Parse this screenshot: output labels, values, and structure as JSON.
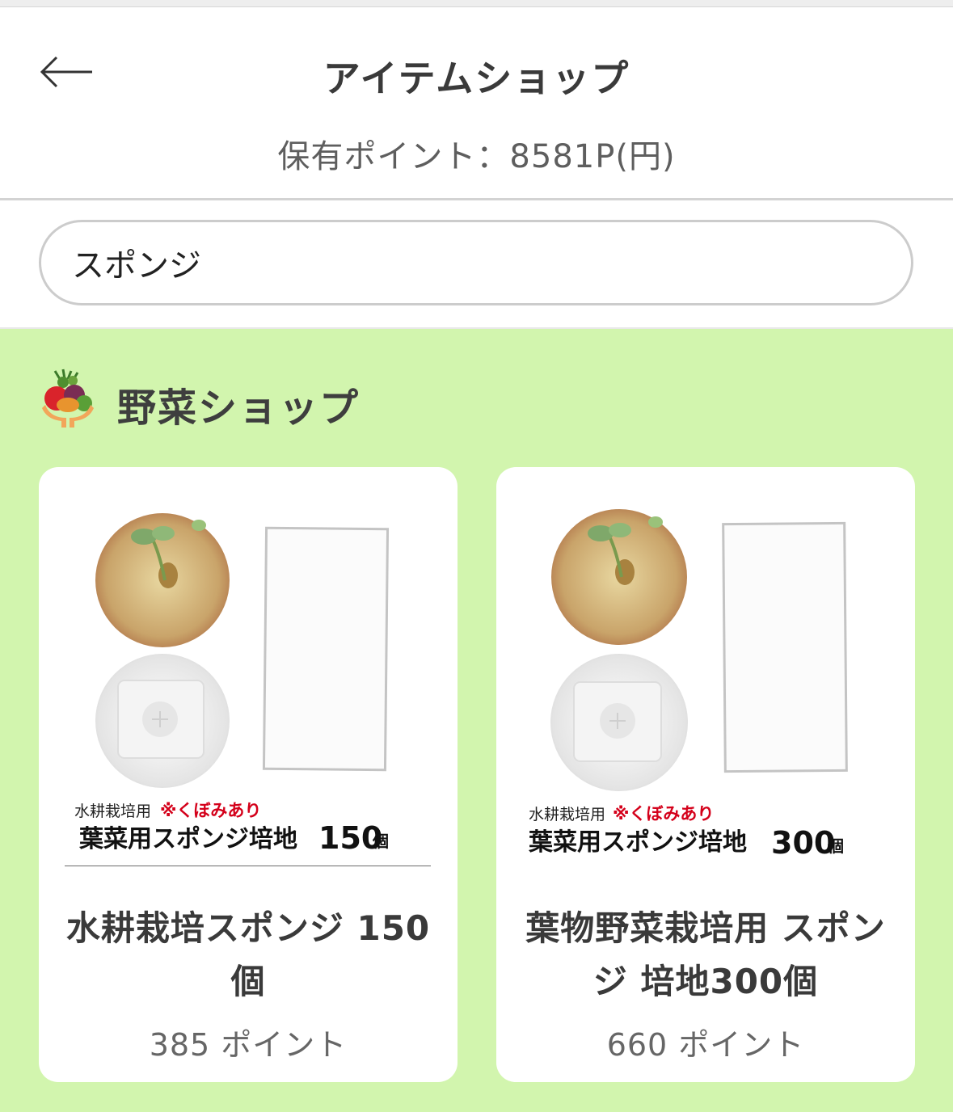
{
  "header": {
    "back_icon": "arrow-left-icon",
    "title": "アイテムショップ",
    "points_label": "保有ポイント：8581P(円)"
  },
  "search": {
    "value": "スポンジ"
  },
  "shop": {
    "icon": "vegetable-shop-icon",
    "title": "野菜ショップ",
    "products": [
      {
        "name": "水耕栽培スポンジ 150個",
        "price": "385 ポイント",
        "image_text": {
          "sub": "水耕栽培用",
          "note": "※くぼみあり",
          "main": "葉菜用スポンジ培地",
          "count": "150",
          "unit": "個"
        }
      },
      {
        "name": "葉物野菜栽培用 スポンジ 培地300個",
        "price": "660 ポイント",
        "image_text": {
          "sub": "水耕栽培用",
          "note": "※くぼみあり",
          "main": "葉菜用スポンジ培地",
          "count": "300",
          "unit": "個"
        }
      }
    ]
  },
  "colors": {
    "shop_background": "#d2f5ae",
    "card_background": "#ffffff",
    "note_red": "#d4001a"
  }
}
